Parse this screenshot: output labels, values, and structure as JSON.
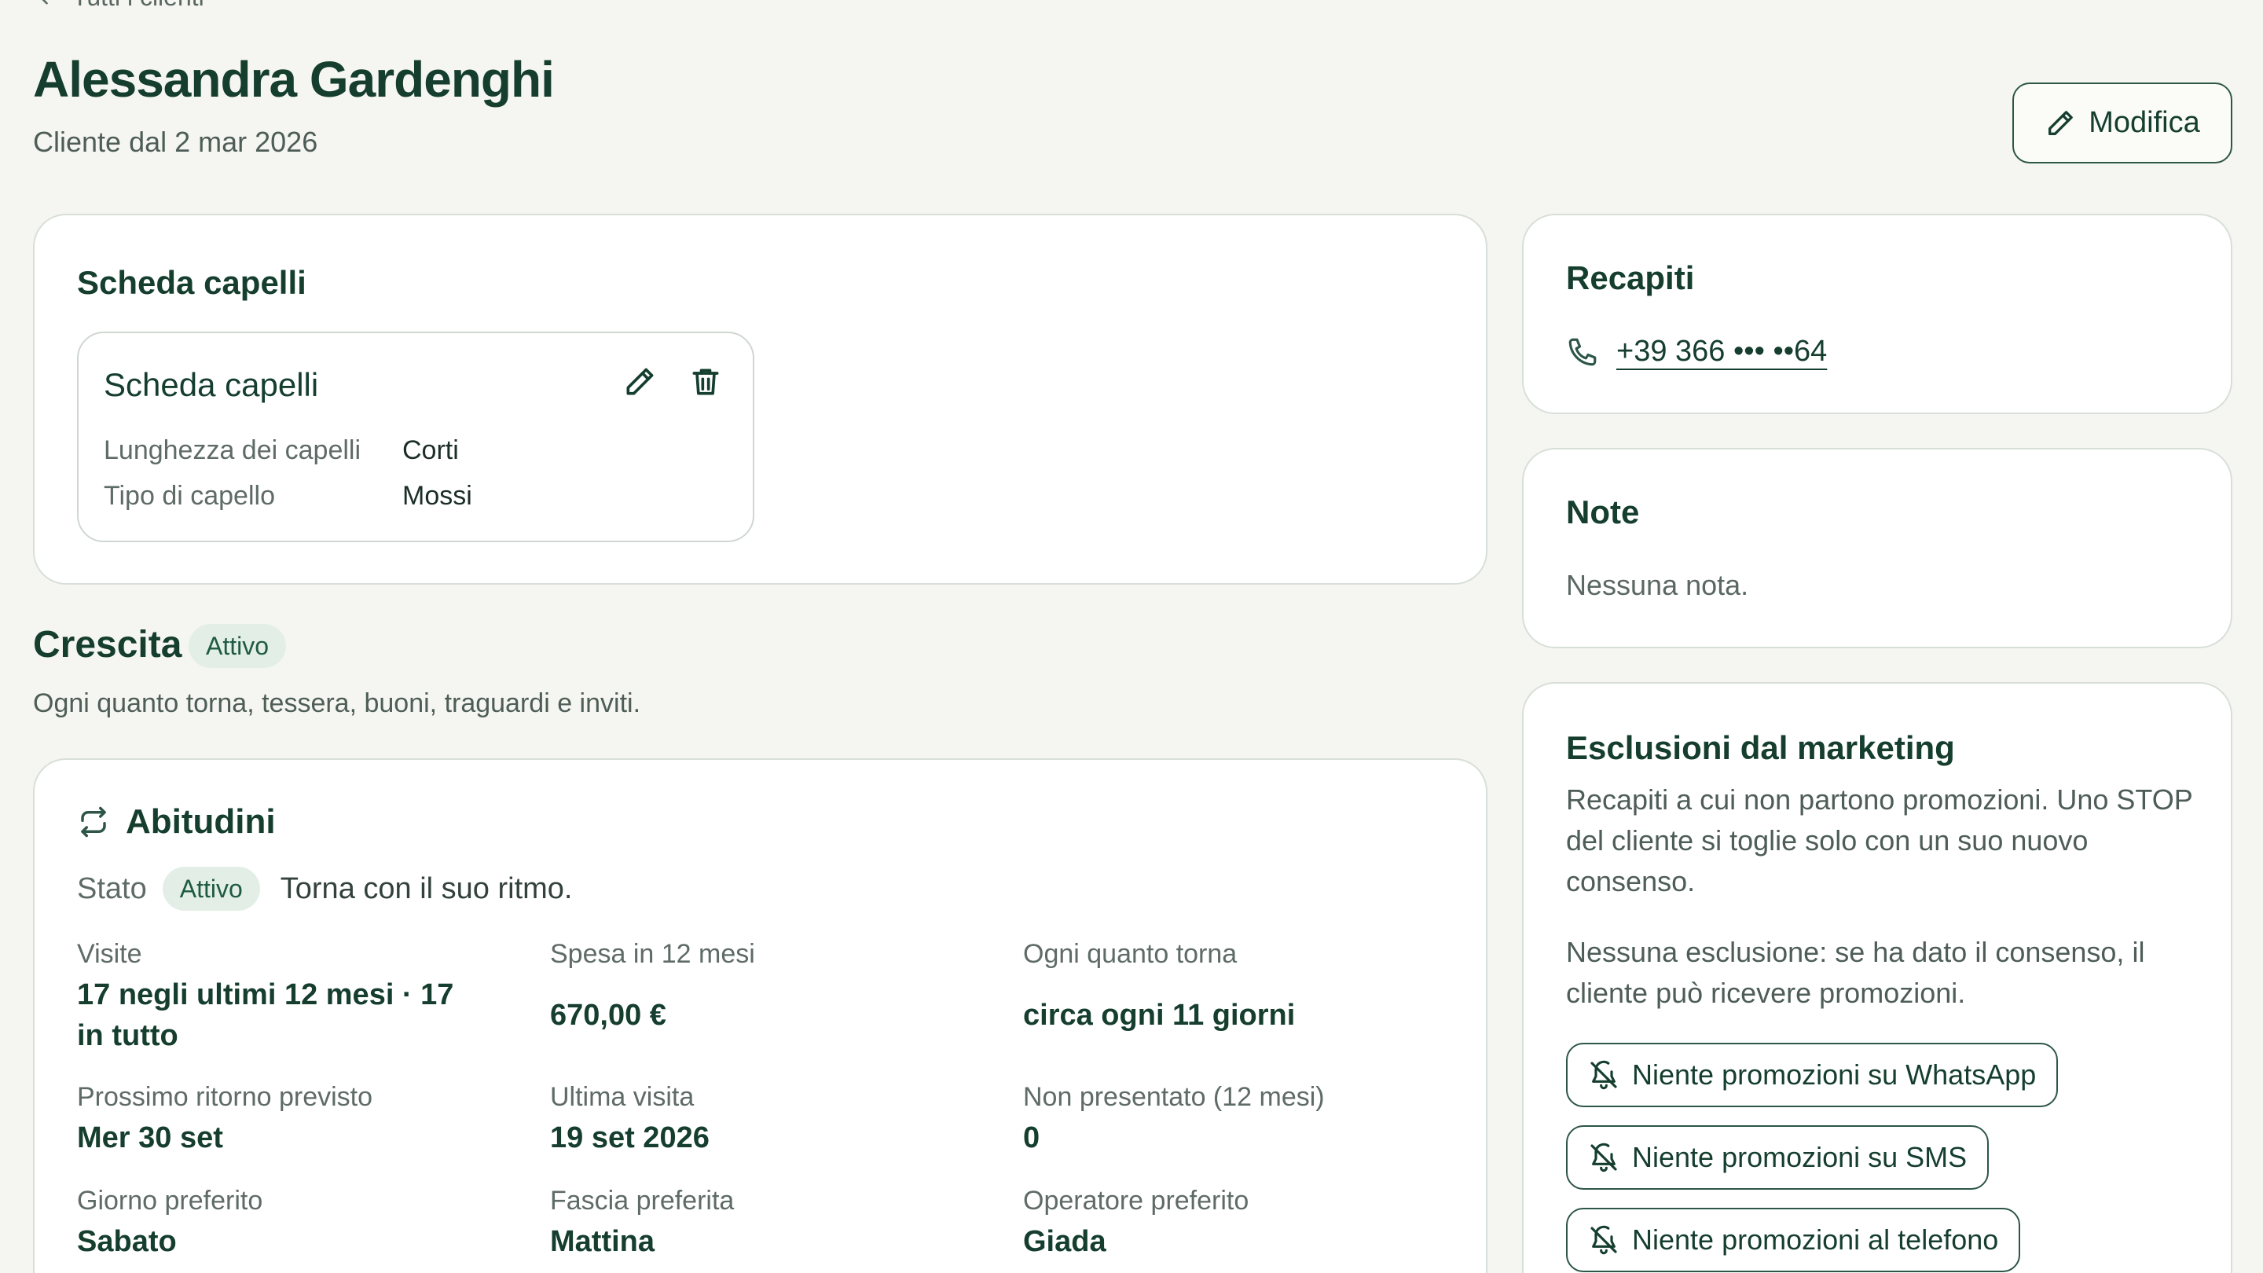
{
  "nav": {
    "back_label": "Tutti i clienti"
  },
  "client": {
    "name": "Alessandra Gardenghi",
    "since": "Cliente dal 2 mar 2026",
    "edit_label": "Modifica"
  },
  "hair": {
    "section_title": "Scheda capelli",
    "card_title": "Scheda capelli",
    "rows": [
      {
        "label": "Lunghezza dei capelli",
        "value": "Corti"
      },
      {
        "label": "Tipo di capello",
        "value": "Mossi"
      }
    ]
  },
  "growth": {
    "title": "Crescita",
    "badge": "Attivo",
    "subtitle": "Ogni quanto torna, tessera, buoni, traguardi e inviti."
  },
  "habits": {
    "title": "Abitudini",
    "state_label": "Stato",
    "state_badge": "Attivo",
    "state_message": "Torna con il suo ritmo.",
    "stats": [
      {
        "label": "Visite",
        "value": "17 negli ultimi 12 mesi · 17 in tutto"
      },
      {
        "label": "Spesa in 12 mesi",
        "value": "670,00 €"
      },
      {
        "label": "Ogni quanto torna",
        "value": "circa ogni 11 giorni"
      },
      {
        "label": "Prossimo ritorno previsto",
        "value": "Mer 30 set"
      },
      {
        "label": "Ultima visita",
        "value": "19 set 2026"
      },
      {
        "label": "Non presentato (12 mesi)",
        "value": "0"
      },
      {
        "label": "Giorno preferito",
        "value": "Sabato"
      },
      {
        "label": "Fascia preferita",
        "value": "Mattina"
      },
      {
        "label": "Operatore preferito",
        "value": "Giada"
      }
    ]
  },
  "contacts": {
    "title": "Recapiti",
    "phone": "+39 366 ••• ••64"
  },
  "notes": {
    "title": "Note",
    "empty": "Nessuna nota."
  },
  "marketing": {
    "title": "Esclusioni dal marketing",
    "description": "Recapiti a cui non partono promozioni. Uno STOP del cliente si toglie solo con un suo nuovo consenso.",
    "none": "Nessuna esclusione: se ha dato il consenso, il cliente può ricevere promozioni.",
    "buttons": [
      "Niente promozioni su WhatsApp",
      "Niente promozioni su SMS",
      "Niente promozioni al telefono"
    ]
  }
}
